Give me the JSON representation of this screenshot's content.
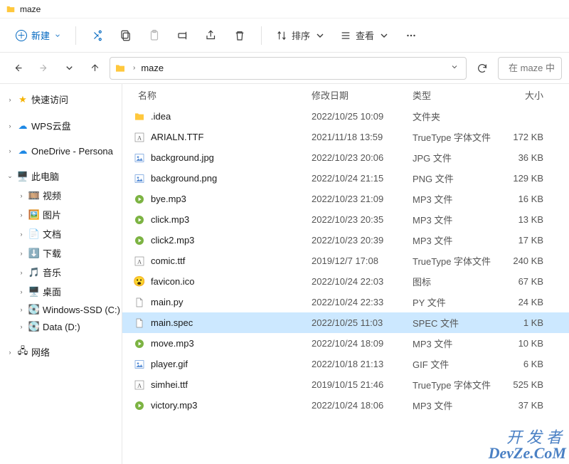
{
  "window": {
    "title": "maze"
  },
  "toolbar": {
    "new_label": "新建",
    "sort_label": "排序",
    "view_label": "查看"
  },
  "breadcrumb": {
    "current": "maze"
  },
  "search": {
    "placeholder": "在 maze 中"
  },
  "sidebar": {
    "quick_access": "快速访问",
    "wps_cloud": "WPS云盘",
    "onedrive": "OneDrive - Persona",
    "this_pc": "此电脑",
    "videos": "视频",
    "pictures": "图片",
    "documents": "文档",
    "downloads": "下载",
    "music": "音乐",
    "desktop": "桌面",
    "windows_ssd": "Windows-SSD (C:)",
    "data_d": "Data (D:)",
    "network": "网络"
  },
  "columns": {
    "name": "名称",
    "date": "修改日期",
    "type": "类型",
    "size": "大小"
  },
  "files": [
    {
      "name": ".idea",
      "date": "2022/10/25 10:09",
      "type": "文件夹",
      "size": "",
      "icon": "folder",
      "selected": false
    },
    {
      "name": "ARIALN.TTF",
      "date": "2021/11/18 13:59",
      "type": "TrueType 字体文件",
      "size": "172 KB",
      "icon": "font",
      "selected": false
    },
    {
      "name": "background.jpg",
      "date": "2022/10/23 20:06",
      "type": "JPG 文件",
      "size": "36 KB",
      "icon": "img",
      "selected": false
    },
    {
      "name": "background.png",
      "date": "2022/10/24 21:15",
      "type": "PNG 文件",
      "size": "129 KB",
      "icon": "img",
      "selected": false
    },
    {
      "name": "bye.mp3",
      "date": "2022/10/23 21:09",
      "type": "MP3 文件",
      "size": "16 KB",
      "icon": "mp3",
      "selected": false
    },
    {
      "name": "click.mp3",
      "date": "2022/10/23 20:35",
      "type": "MP3 文件",
      "size": "13 KB",
      "icon": "mp3",
      "selected": false
    },
    {
      "name": "click2.mp3",
      "date": "2022/10/23 20:39",
      "type": "MP3 文件",
      "size": "17 KB",
      "icon": "mp3",
      "selected": false
    },
    {
      "name": "comic.ttf",
      "date": "2019/12/7 17:08",
      "type": "TrueType 字体文件",
      "size": "240 KB",
      "icon": "font",
      "selected": false
    },
    {
      "name": "favicon.ico",
      "date": "2022/10/24 22:03",
      "type": "图标",
      "size": "67 KB",
      "icon": "ico",
      "selected": false
    },
    {
      "name": "main.py",
      "date": "2022/10/24 22:33",
      "type": "PY 文件",
      "size": "24 KB",
      "icon": "file",
      "selected": false
    },
    {
      "name": "main.spec",
      "date": "2022/10/25 11:03",
      "type": "SPEC 文件",
      "size": "1 KB",
      "icon": "file",
      "selected": true
    },
    {
      "name": "move.mp3",
      "date": "2022/10/24 18:09",
      "type": "MP3 文件",
      "size": "10 KB",
      "icon": "mp3",
      "selected": false
    },
    {
      "name": "player.gif",
      "date": "2022/10/18 21:13",
      "type": "GIF 文件",
      "size": "6 KB",
      "icon": "img",
      "selected": false
    },
    {
      "name": "simhei.ttf",
      "date": "2019/10/15 21:46",
      "type": "TrueType 字体文件",
      "size": "525 KB",
      "icon": "font",
      "selected": false
    },
    {
      "name": "victory.mp3",
      "date": "2022/10/24 18:06",
      "type": "MP3 文件",
      "size": "37 KB",
      "icon": "mp3",
      "selected": false
    }
  ],
  "watermark": {
    "line1": "开发者",
    "line2": "DevZe.CoM"
  }
}
